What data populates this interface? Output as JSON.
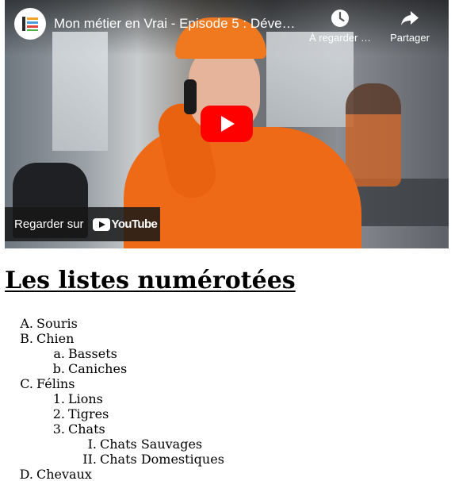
{
  "video": {
    "title": "Mon métier en Vrai - Episode 5 : Déve…",
    "watch_later_label": "À regarder …",
    "share_label": "Partager",
    "watch_on_label": "Regarder sur",
    "youtube_logo_text": "YouTube",
    "play_color": "#ff0000"
  },
  "page": {
    "title": "Les listes numérotées"
  },
  "list": [
    {
      "marker": "A.",
      "label": "Souris"
    },
    {
      "marker": "B.",
      "label": "Chien",
      "children": [
        {
          "marker": "a.",
          "label": "Bassets"
        },
        {
          "marker": "b.",
          "label": "Caniches"
        }
      ]
    },
    {
      "marker": "C.",
      "label": "Félins",
      "children": [
        {
          "marker": "1.",
          "label": "Lions"
        },
        {
          "marker": "2.",
          "label": "Tigres"
        },
        {
          "marker": "3.",
          "label": "Chats",
          "children": [
            {
              "marker": "I.",
              "label": "Chats Sauvages"
            },
            {
              "marker": "II.",
              "label": "Chats Domestiques"
            }
          ]
        }
      ]
    },
    {
      "marker": "D.",
      "label": "Chevaux"
    }
  ]
}
